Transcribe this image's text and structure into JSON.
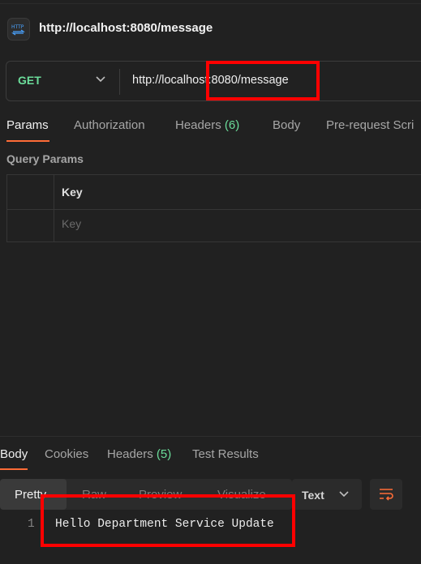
{
  "request": {
    "title": "http://localhost:8080/message",
    "icon": "http-icon",
    "method": "GET",
    "url": "http://localhost:8080/message"
  },
  "request_tabs": {
    "params": "Params",
    "authorization": "Authorization",
    "headers": "Headers",
    "headers_count": "(6)",
    "body": "Body",
    "prerequest": "Pre-request Scri"
  },
  "query_params": {
    "label": "Query Params",
    "key_header": "Key",
    "key_placeholder": "Key"
  },
  "response_tabs": {
    "body": "Body",
    "cookies": "Cookies",
    "headers": "Headers",
    "headers_count": "(5)",
    "test_results": "Test Results"
  },
  "view_modes": {
    "pretty": "Pretty",
    "raw": "Raw",
    "preview": "Preview",
    "visualize": "Visualize"
  },
  "format": {
    "selected": "Text"
  },
  "response_body": {
    "line_number": "1",
    "text": "Hello Department Service Update"
  },
  "colors": {
    "accent": "#ff6c37",
    "method_get": "#6bdd9a",
    "count": "#6bdd9a",
    "annotation": "#ff0000"
  }
}
